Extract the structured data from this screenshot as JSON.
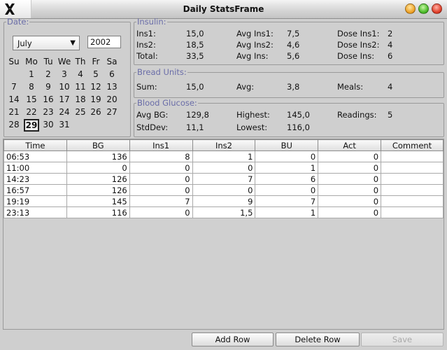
{
  "window": {
    "title": "Daily StatsFrame"
  },
  "date": {
    "legend": "Date:",
    "month": "July",
    "year": "2002",
    "weekdays": [
      "Su",
      "Mo",
      "Tu",
      "We",
      "Th",
      "Fr",
      "Sa"
    ],
    "selected_day": "29",
    "weeks": [
      [
        "",
        "1",
        "2",
        "3",
        "4",
        "5",
        "6"
      ],
      [
        "7",
        "8",
        "9",
        "10",
        "11",
        "12",
        "13"
      ],
      [
        "14",
        "15",
        "16",
        "17",
        "18",
        "19",
        "20"
      ],
      [
        "21",
        "22",
        "23",
        "24",
        "25",
        "26",
        "27"
      ],
      [
        "28",
        "29",
        "30",
        "31",
        "",
        "",
        ""
      ]
    ]
  },
  "insulin": {
    "legend": "Insulin:",
    "ins1_label": "Ins1:",
    "ins1": "15,0",
    "ins2_label": "Ins2:",
    "ins2": "18,5",
    "total_label": "Total:",
    "total": "33,5",
    "avg_ins1_label": "Avg Ins1:",
    "avg_ins1": "7,5",
    "avg_ins2_label": "Avg Ins2:",
    "avg_ins2": "4,6",
    "avg_ins_label": "Avg Ins:",
    "avg_ins": "5,6",
    "dose_ins1_label": "Dose Ins1:",
    "dose_ins1": "2",
    "dose_ins2_label": "Dose Ins2:",
    "dose_ins2": "4",
    "dose_ins_label": "Dose Ins:",
    "dose_ins": "6"
  },
  "bread_units": {
    "legend": "Bread Units:",
    "sum_label": "Sum:",
    "sum": "15,0",
    "avg_label": "Avg:",
    "avg": "3,8",
    "meals_label": "Meals:",
    "meals": "4"
  },
  "blood_glucose": {
    "legend": "Blood Glucose:",
    "avg_bg_label": "Avg BG:",
    "avg_bg": "129,8",
    "stddev_label": "StdDev:",
    "stddev": "11,1",
    "highest_label": "Highest:",
    "highest": "145,0",
    "lowest_label": "Lowest:",
    "lowest": "116,0",
    "readings_label": "Readings:",
    "readings": "5"
  },
  "table": {
    "columns": [
      "Time",
      "BG",
      "Ins1",
      "Ins2",
      "BU",
      "Act",
      "Comment"
    ],
    "rows": [
      [
        "06:53",
        "136",
        "8",
        "1",
        "0",
        "0",
        ""
      ],
      [
        "11:00",
        "0",
        "0",
        "0",
        "1",
        "0",
        ""
      ],
      [
        "14:23",
        "126",
        "0",
        "7",
        "6",
        "0",
        ""
      ],
      [
        "16:57",
        "126",
        "0",
        "0",
        "0",
        "0",
        ""
      ],
      [
        "19:19",
        "145",
        "7",
        "9",
        "7",
        "0",
        ""
      ],
      [
        "23:13",
        "116",
        "0",
        "1,5",
        "1",
        "0",
        ""
      ]
    ]
  },
  "buttons": {
    "add_row": "Add Row",
    "delete_row": "Delete Row",
    "save": "Save"
  }
}
